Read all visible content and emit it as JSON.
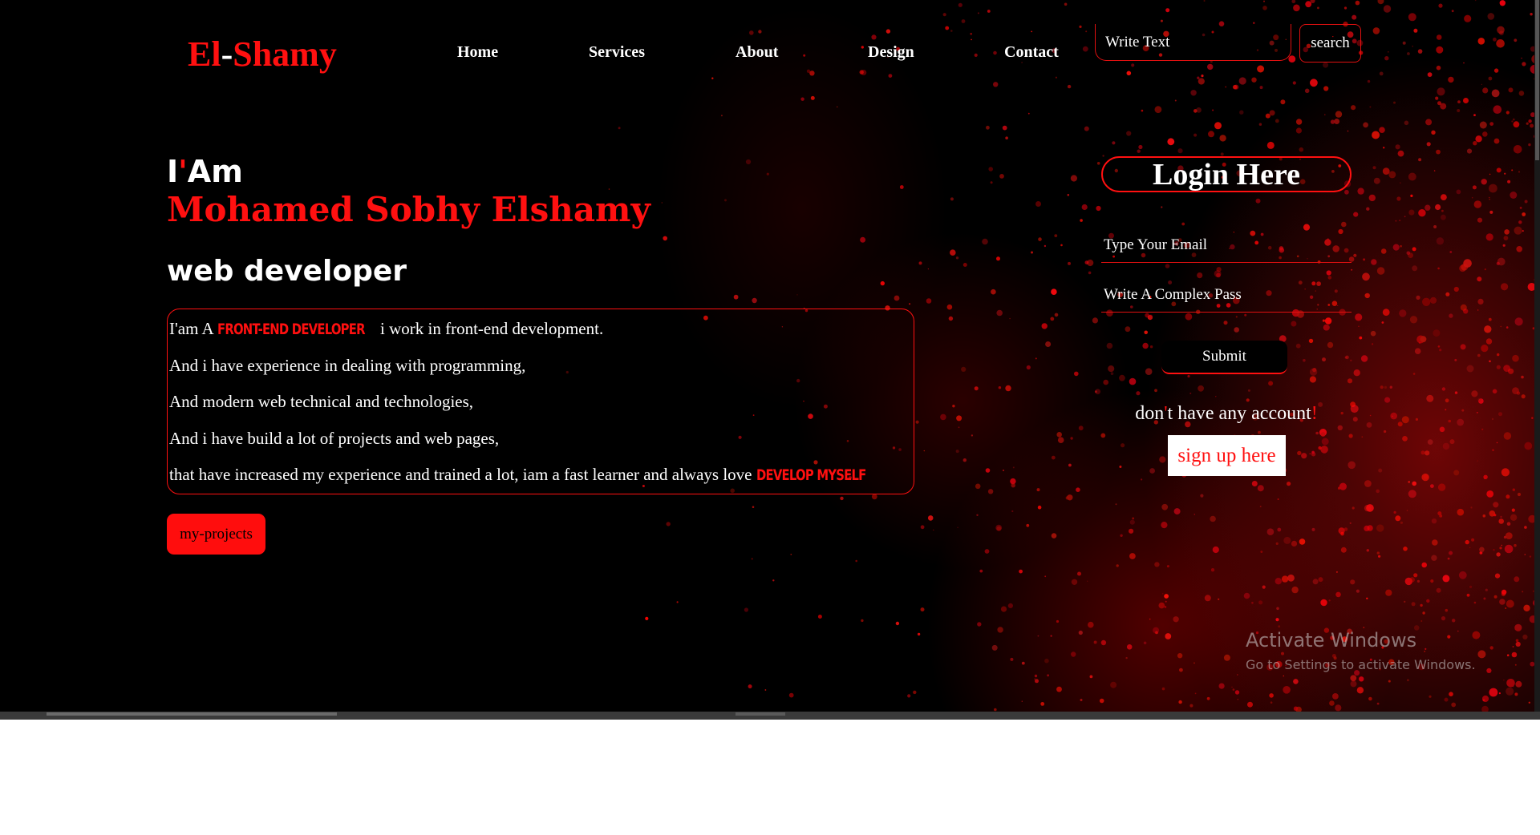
{
  "header": {
    "logo": {
      "left": "El",
      "dash": "-",
      "right": "Shamy"
    },
    "nav": [
      "Home",
      "Services",
      "About",
      "Design",
      "Contact"
    ],
    "search": {
      "value": "Write Text",
      "button_label": "search"
    }
  },
  "hero": {
    "iam": {
      "i": "I",
      "apostrophe": "'",
      "am": "Am"
    },
    "name": "Mohamed Sobhy Elshamy",
    "role": "web developer",
    "bio": {
      "line1_a": "I'am A ",
      "line1_hl": "FRONT-END DEVELOPER",
      "line1_b": " i work in front-end development.",
      "line2": "And i have experience in dealing with programming,",
      "line3": "And modern web technical and technologies,",
      "line4": "And i have build a lot of projects and web pages,",
      "line5_a": "that have increased my experience and trained a lot, iam a fast learner and always love ",
      "line5_hl": "DEVELOP MYSELF"
    },
    "projects_button": "my-projects"
  },
  "login": {
    "title": "Login Here",
    "email_placeholder": "Type Your Email",
    "password_placeholder": "Write A Complex Pass",
    "submit_label": "Submit",
    "no_account": {
      "a": "don",
      "apostrophe": "'",
      "b": "t have any account",
      "mark": "!"
    },
    "signup_label": "sign up here"
  },
  "watermark": {
    "title": "Activate Windows",
    "subtitle": "Go to Settings to activate Windows."
  },
  "colors": {
    "accent": "#ff1010",
    "background": "#000000",
    "text": "#ffffff"
  }
}
